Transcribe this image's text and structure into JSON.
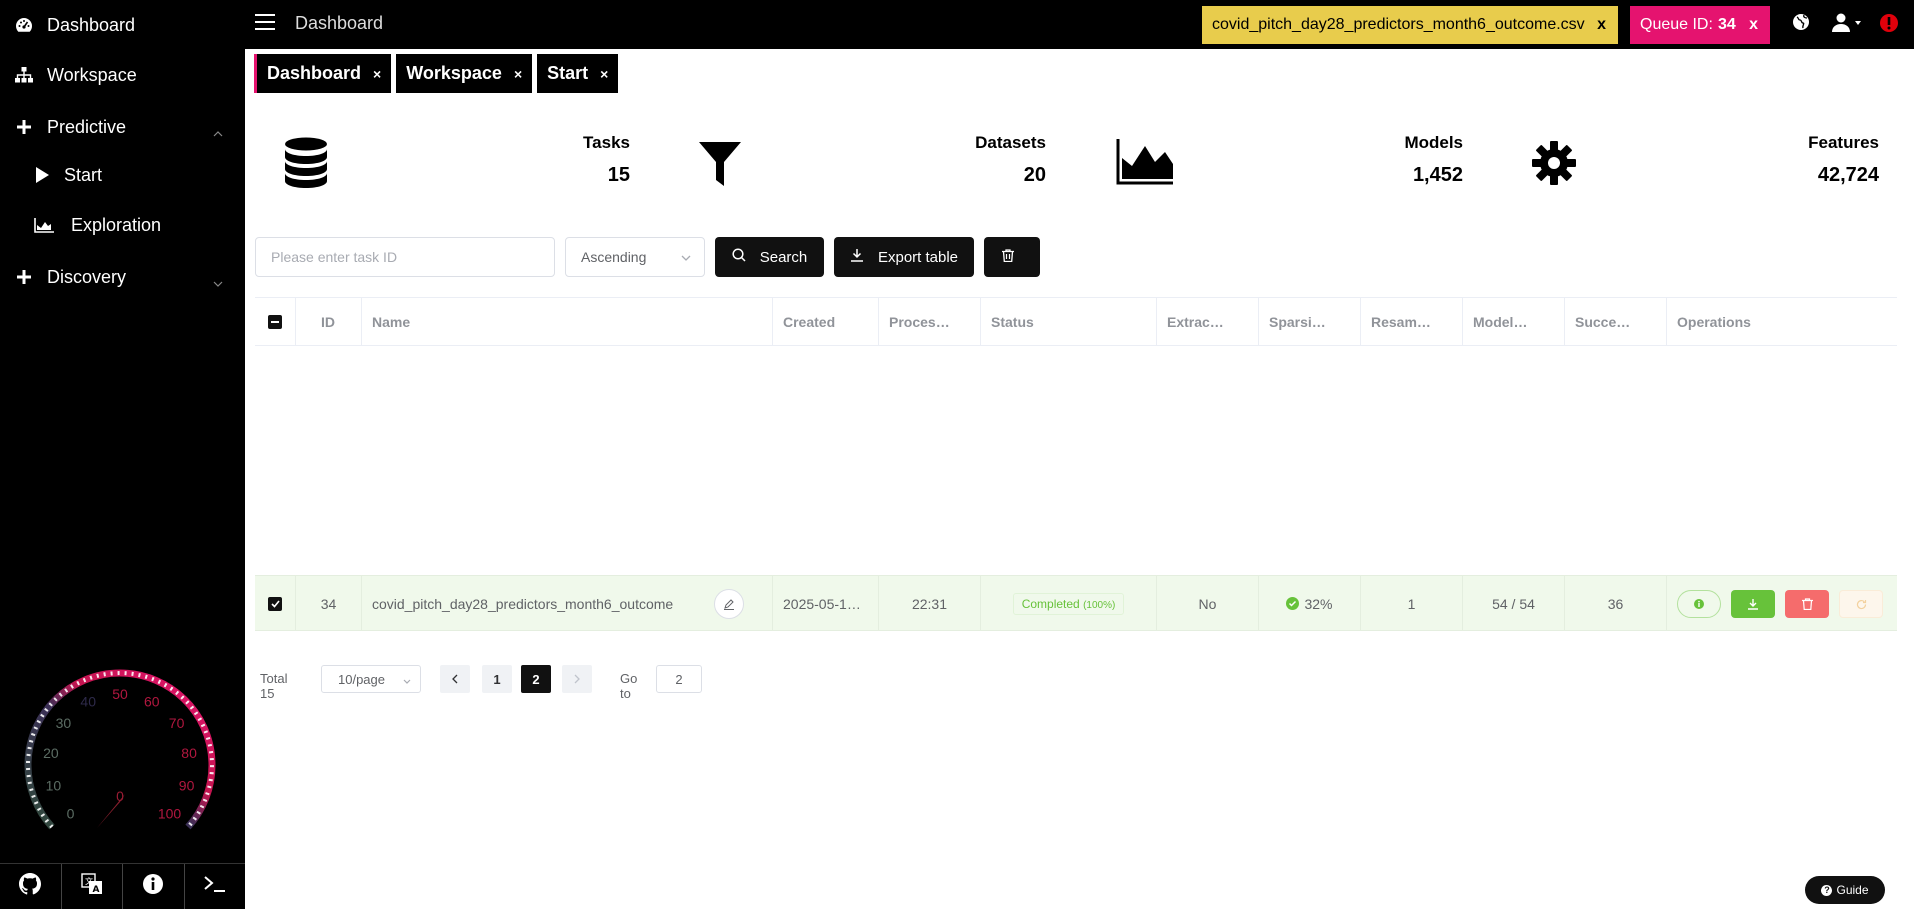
{
  "sidebar": {
    "items": [
      {
        "label": "Dashboard",
        "icon": "dashboard-icon"
      },
      {
        "label": "Workspace",
        "icon": "sitemap-icon"
      },
      {
        "label": "Predictive",
        "icon": "plus-icon",
        "expanded": true
      },
      {
        "label": "Start",
        "icon": "play-icon"
      },
      {
        "label": "Exploration",
        "icon": "area-chart-icon"
      },
      {
        "label": "Discovery",
        "icon": "plus-icon",
        "expanded": false
      }
    ],
    "gauge": {
      "ticks": [
        "0",
        "10",
        "20",
        "30",
        "40",
        "50",
        "60",
        "70",
        "80",
        "90",
        "100"
      ],
      "value": 0,
      "value_label": "0"
    },
    "bottom_buttons": [
      "github-icon",
      "translate-icon",
      "info-icon",
      "terminal-icon"
    ]
  },
  "topbar": {
    "title": "Dashboard",
    "file_tag": "covid_pitch_day28_predictors_month6_outcome.csv",
    "file_tag_close": "x",
    "queue_label": "Queue ID:",
    "queue_id": "34",
    "queue_close": "x",
    "colors": {
      "file_tag": "#e8cc4c",
      "queue_tag": "#e5136f",
      "alert": "#e0000b"
    }
  },
  "tabs": [
    {
      "label": "Dashboard",
      "close": "×",
      "active": true
    },
    {
      "label": "Workspace",
      "close": "×",
      "active": false
    },
    {
      "label": "Start",
      "close": "×",
      "active": false
    }
  ],
  "stats": [
    {
      "label": "Tasks",
      "value": "15",
      "icon": "database-icon"
    },
    {
      "label": "Datasets",
      "value": "20",
      "icon": "filter-icon"
    },
    {
      "label": "Models",
      "value": "1,452",
      "icon": "area-chart-icon"
    },
    {
      "label": "Features",
      "value": "42,724",
      "icon": "gear-icon"
    }
  ],
  "toolbar": {
    "search_placeholder": "Please enter task ID",
    "sort_value": "Ascending",
    "search_label": "Search",
    "export_label": "Export table"
  },
  "table": {
    "columns": [
      "ID",
      "Name",
      "Created",
      "Proces…",
      "Status",
      "Extrac…",
      "Sparsi…",
      "Resam…",
      "Model…",
      "Succe…",
      "Operations"
    ],
    "rows": [
      {
        "id": "34",
        "name": "covid_pitch_day28_predictors_month6_outcome",
        "created": "2025-05-1…",
        "processing": "22:31",
        "status": "Completed",
        "status_pct": "(100%)",
        "extraction": "No",
        "sparsity": "32%",
        "resampling": "1",
        "models": "54 / 54",
        "success": "36",
        "selected": true
      }
    ]
  },
  "pagination": {
    "total": "Total 15",
    "page_size": "10/page",
    "pages": [
      "1",
      "2"
    ],
    "current_page": "2",
    "goto_label": "Go to",
    "goto_value": "2"
  },
  "guide": {
    "label": "Guide"
  }
}
